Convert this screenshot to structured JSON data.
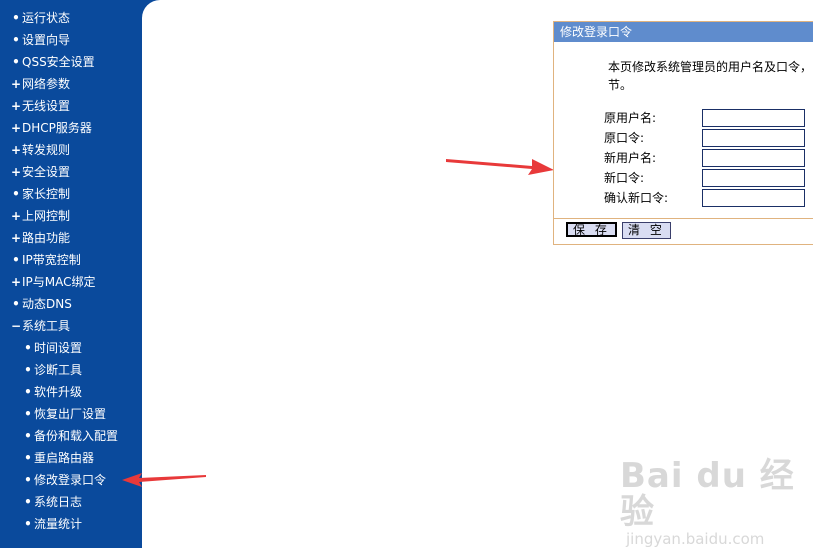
{
  "sidebar": {
    "items": [
      {
        "label": "运行状态",
        "mark": "•"
      },
      {
        "label": "设置向导",
        "mark": "•"
      },
      {
        "label": "QSS安全设置",
        "mark": "•"
      },
      {
        "label": "网络参数",
        "mark": "+"
      },
      {
        "label": "无线设置",
        "mark": "+"
      },
      {
        "label": "DHCP服务器",
        "mark": "+"
      },
      {
        "label": "转发规则",
        "mark": "+"
      },
      {
        "label": "安全设置",
        "mark": "+"
      },
      {
        "label": "家长控制",
        "mark": "•"
      },
      {
        "label": "上网控制",
        "mark": "+"
      },
      {
        "label": "路由功能",
        "mark": "+"
      },
      {
        "label": "IP带宽控制",
        "mark": "•"
      },
      {
        "label": "IP与MAC绑定",
        "mark": "+"
      },
      {
        "label": "动态DNS",
        "mark": "•"
      },
      {
        "label": "系统工具",
        "mark": "−"
      }
    ],
    "subitems": [
      {
        "label": "时间设置",
        "mark": "•"
      },
      {
        "label": "诊断工具",
        "mark": "•"
      },
      {
        "label": "软件升级",
        "mark": "•"
      },
      {
        "label": "恢复出厂设置",
        "mark": "•"
      },
      {
        "label": "备份和载入配置",
        "mark": "•"
      },
      {
        "label": "重启路由器",
        "mark": "•"
      },
      {
        "label": "修改登录口令",
        "mark": "•"
      },
      {
        "label": "系统日志",
        "mark": "•"
      },
      {
        "label": "流量统计",
        "mark": "•"
      }
    ]
  },
  "panel": {
    "title": "修改登录口令",
    "description": "本页修改系统管理员的用户名及口令，节。",
    "fields": [
      {
        "label": "原用户名:",
        "value": ""
      },
      {
        "label": "原口令:",
        "value": ""
      },
      {
        "label": "新用户名:",
        "value": ""
      },
      {
        "label": "新口令:",
        "value": ""
      },
      {
        "label": "确认新口令:",
        "value": ""
      }
    ],
    "save_label": "保 存",
    "clear_label": "清 空"
  },
  "watermark": {
    "logo": "Bai du 经验",
    "url": "jingyan.baidu.com"
  },
  "colors": {
    "sidebar_bg": "#0a4a9c",
    "panel_header_bg": "#5f8ccd",
    "panel_border": "#e0b37f",
    "arrow": "#e8393a"
  },
  "icons": {
    "arrow_annotation": "red-arrow-icon"
  }
}
